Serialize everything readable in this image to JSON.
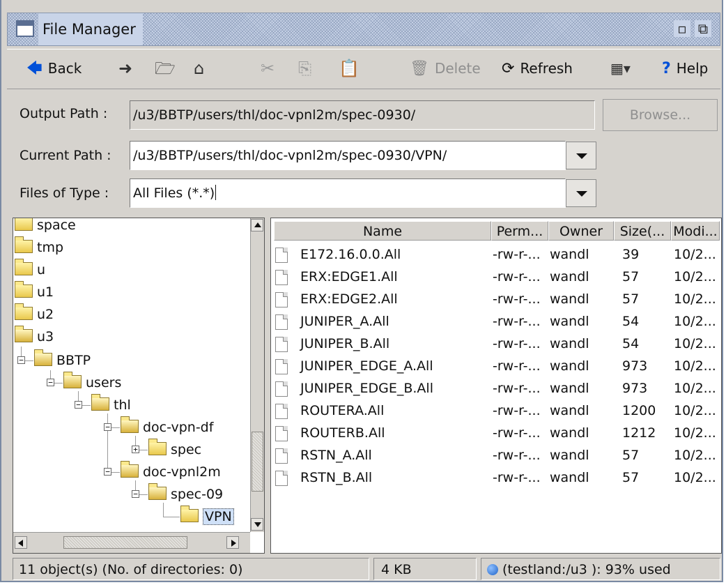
{
  "window": {
    "title": "File Manager",
    "title_icon": "window-icon",
    "minimize_icon": "restore-down-icon",
    "maximize_icon": "maximize-icon"
  },
  "toolbar": {
    "back_label": "Back",
    "forward_icon": "arrow-right-icon",
    "up_icon": "folder-up-icon",
    "home_icon": "home-icon",
    "cut_icon": "scissors-icon",
    "copy_icon": "copy-icon",
    "paste_icon": "paste-icon",
    "delete_label": "Delete",
    "refresh_label": "Refresh",
    "view_icon": "view-details-icon",
    "help_label": "Help",
    "accent_color": "#0050d8"
  },
  "form": {
    "output_label": "Output Path  :",
    "output_value": "/u3/BBTP/users/thl/doc-vpnl2m/spec-0930/",
    "browse_label": "Browse...",
    "current_label": "Current Path :",
    "current_value": "/u3/BBTP/users/thl/doc-vpnl2m/spec-0930/VPN/",
    "type_label": "Files of Type :",
    "type_value": "All Files (*.*)"
  },
  "tree": {
    "items": [
      {
        "label": "space"
      },
      {
        "label": "tmp"
      },
      {
        "label": "u"
      },
      {
        "label": "u1"
      },
      {
        "label": "u2"
      },
      {
        "label": "u3"
      },
      {
        "label": "BBTP"
      },
      {
        "label": "users"
      },
      {
        "label": "thl"
      },
      {
        "label": "doc-vpn-df"
      },
      {
        "label": "spec"
      },
      {
        "label": "doc-vpnl2m"
      },
      {
        "label": "spec-09"
      },
      {
        "label": "VPN"
      }
    ],
    "selected": "VPN"
  },
  "files": {
    "columns": [
      "Name",
      "Perm...",
      "Owner",
      "Size(...",
      "Modi..."
    ],
    "rows": [
      {
        "name": "E172.16.0.0.All",
        "perm": "-rw-r-...",
        "owner": "wandl",
        "size": "39",
        "modified": "10/2..."
      },
      {
        "name": "ERX:EDGE1.All",
        "perm": "-rw-r-...",
        "owner": "wandl",
        "size": "57",
        "modified": "10/2..."
      },
      {
        "name": "ERX:EDGE2.All",
        "perm": "-rw-r-...",
        "owner": "wandl",
        "size": "57",
        "modified": "10/2..."
      },
      {
        "name": "JUNIPER_A.All",
        "perm": "-rw-r-...",
        "owner": "wandl",
        "size": "54",
        "modified": "10/2..."
      },
      {
        "name": "JUNIPER_B.All",
        "perm": "-rw-r-...",
        "owner": "wandl",
        "size": "54",
        "modified": "10/2..."
      },
      {
        "name": "JUNIPER_EDGE_A.All",
        "perm": "-rw-r-...",
        "owner": "wandl",
        "size": "973",
        "modified": "10/2..."
      },
      {
        "name": "JUNIPER_EDGE_B.All",
        "perm": "-rw-r-...",
        "owner": "wandl",
        "size": "973",
        "modified": "10/2..."
      },
      {
        "name": "ROUTERA.All",
        "perm": "-rw-r-...",
        "owner": "wandl",
        "size": "1200",
        "modified": "10/2..."
      },
      {
        "name": "ROUTERB.All",
        "perm": "-rw-r-...",
        "owner": "wandl",
        "size": "1212",
        "modified": "10/2..."
      },
      {
        "name": "RSTN_A.All",
        "perm": "-rw-r-...",
        "owner": "wandl",
        "size": "57",
        "modified": "10/2..."
      },
      {
        "name": "RSTN_B.All",
        "perm": "-rw-r-...",
        "owner": "wandl",
        "size": "57",
        "modified": "10/2..."
      }
    ]
  },
  "status": {
    "objects": "11 object(s) (No. of directories: 0)",
    "size": "4 KB",
    "disk": "(testland:/u3 ): 93% used"
  }
}
